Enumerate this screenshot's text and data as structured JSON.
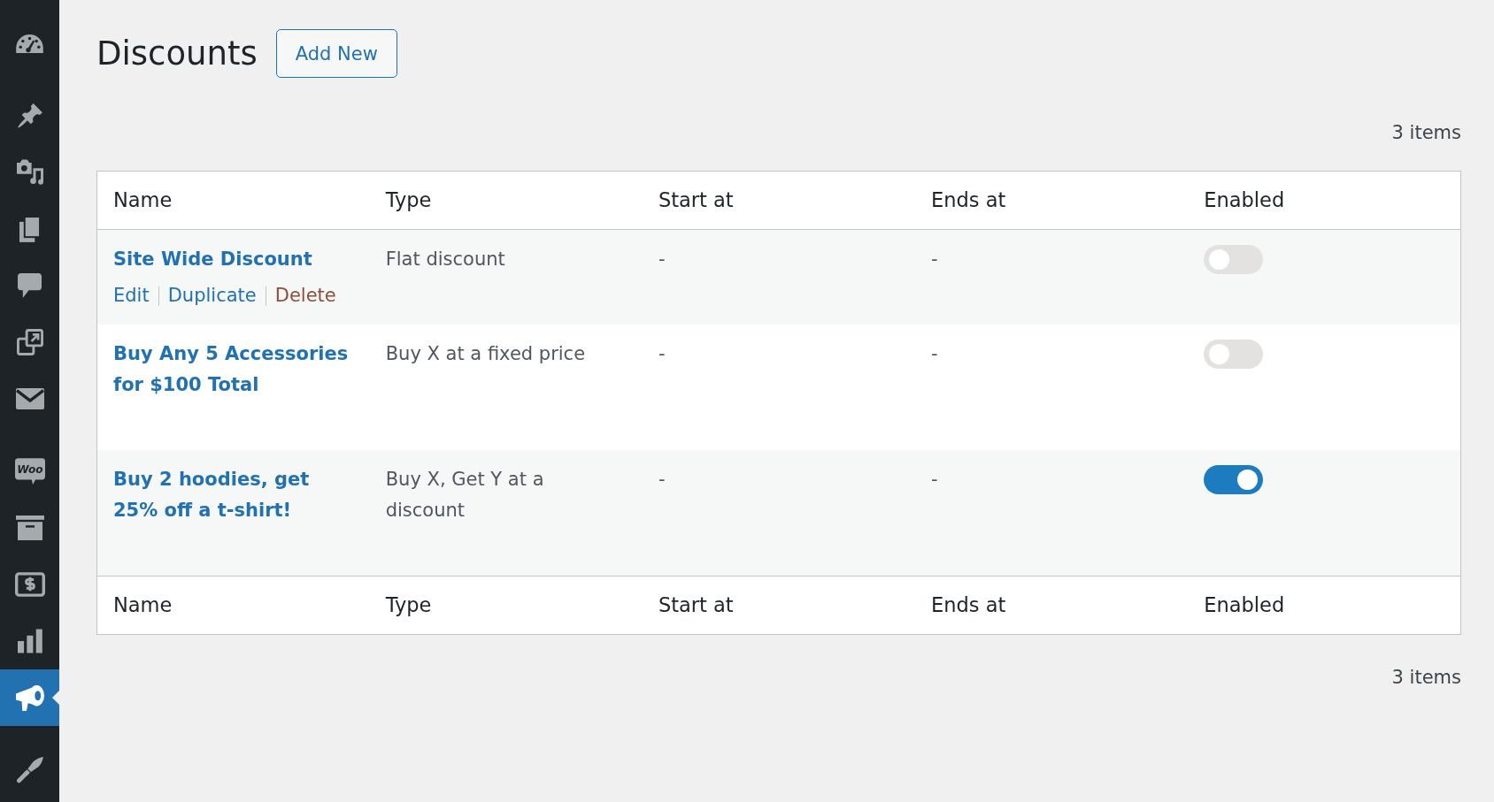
{
  "sidebar": {
    "groups": [
      {
        "items": [
          {
            "kind": "gauge",
            "selected": false
          }
        ]
      },
      {
        "items": [
          {
            "kind": "pin",
            "selected": false
          },
          {
            "kind": "media",
            "selected": false
          },
          {
            "kind": "pages",
            "selected": false
          },
          {
            "kind": "comment",
            "selected": false
          },
          {
            "kind": "external",
            "selected": false
          },
          {
            "kind": "mail",
            "selected": false
          }
        ]
      },
      {
        "items": [
          {
            "kind": "logo",
            "text": "Woo",
            "selected": false
          },
          {
            "kind": "archive",
            "selected": false
          },
          {
            "kind": "dollar",
            "selected": false
          },
          {
            "kind": "chart",
            "selected": false
          },
          {
            "kind": "megaphone",
            "selected": true
          }
        ]
      },
      {
        "items": [
          {
            "kind": "brush",
            "selected": false
          }
        ]
      }
    ]
  },
  "header": {
    "title": "Discounts",
    "add_button": "Add New"
  },
  "table": {
    "count_top": "3 items",
    "columns": [
      "Name",
      "Type",
      "Start at",
      "Ends at",
      "Enabled"
    ],
    "rows": [
      {
        "name": "Site Wide Discount",
        "actions": [
          {
            "label": "Edit",
            "kind": "link"
          },
          {
            "label": "Duplicate",
            "kind": "link"
          },
          {
            "label": "Delete",
            "kind": "delete"
          }
        ],
        "type": "Flat discount",
        "start_at": "-",
        "ends_at": "-",
        "enabled": false
      },
      {
        "name": "Buy Any 5 Accessories for $100 Total",
        "type": "Buy X at a fixed price",
        "start_at": "-",
        "ends_at": "-",
        "enabled": false
      },
      {
        "name": "Buy 2 hoodies, get 25% off a t-shirt!",
        "type": "Buy X, Get Y at a discount",
        "start_at": "-",
        "ends_at": "-",
        "enabled": true
      }
    ],
    "footer_columns": [
      "Name",
      "Type",
      "Start at",
      "Ends at",
      "Enabled"
    ],
    "count_bottom": "3 items"
  }
}
